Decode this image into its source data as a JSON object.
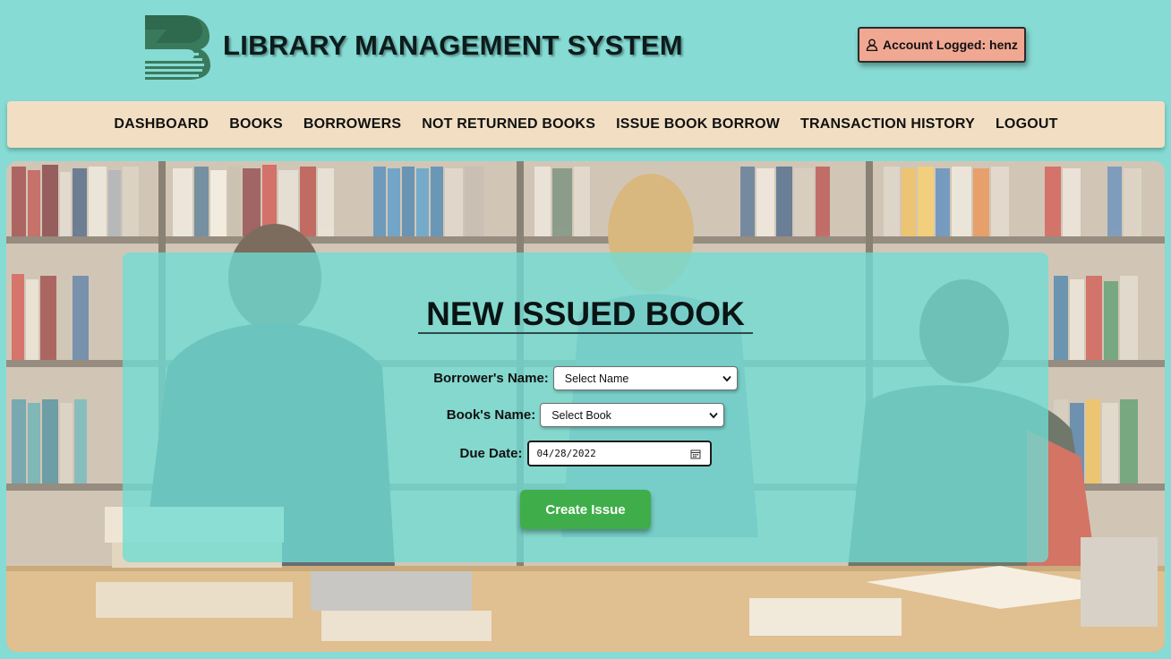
{
  "header": {
    "title": "LIBRARY MANAGEMENT SYSTEM",
    "account_label": "Account Logged: henz",
    "logo_icon": "library-book-logo-icon",
    "user_icon": "user-icon"
  },
  "nav": {
    "items": [
      {
        "label": "DASHBOARD"
      },
      {
        "label": "BOOKS"
      },
      {
        "label": "BORROWERS"
      },
      {
        "label": "NOT RETURNED BOOKS"
      },
      {
        "label": "ISSUE BOOK BORROW"
      },
      {
        "label": "TRANSACTION HISTORY"
      },
      {
        "label": "LOGOUT"
      }
    ]
  },
  "form": {
    "title": "NEW ISSUED BOOK",
    "borrower_label": "Borrower's Name:",
    "borrower_value": "Select Name",
    "book_label": "Book's Name:",
    "book_value": "Select Book",
    "due_label": "Due Date:",
    "due_value": "04/28/2022",
    "submit_label": "Create Issue"
  },
  "colors": {
    "page_bg": "#86dbd4",
    "nav_bg": "#f2dfc3",
    "account_bg": "#f0a893",
    "card_bg": "#6edcd4",
    "button_bg": "#3fae4a",
    "logo": "#3a7a5c"
  }
}
